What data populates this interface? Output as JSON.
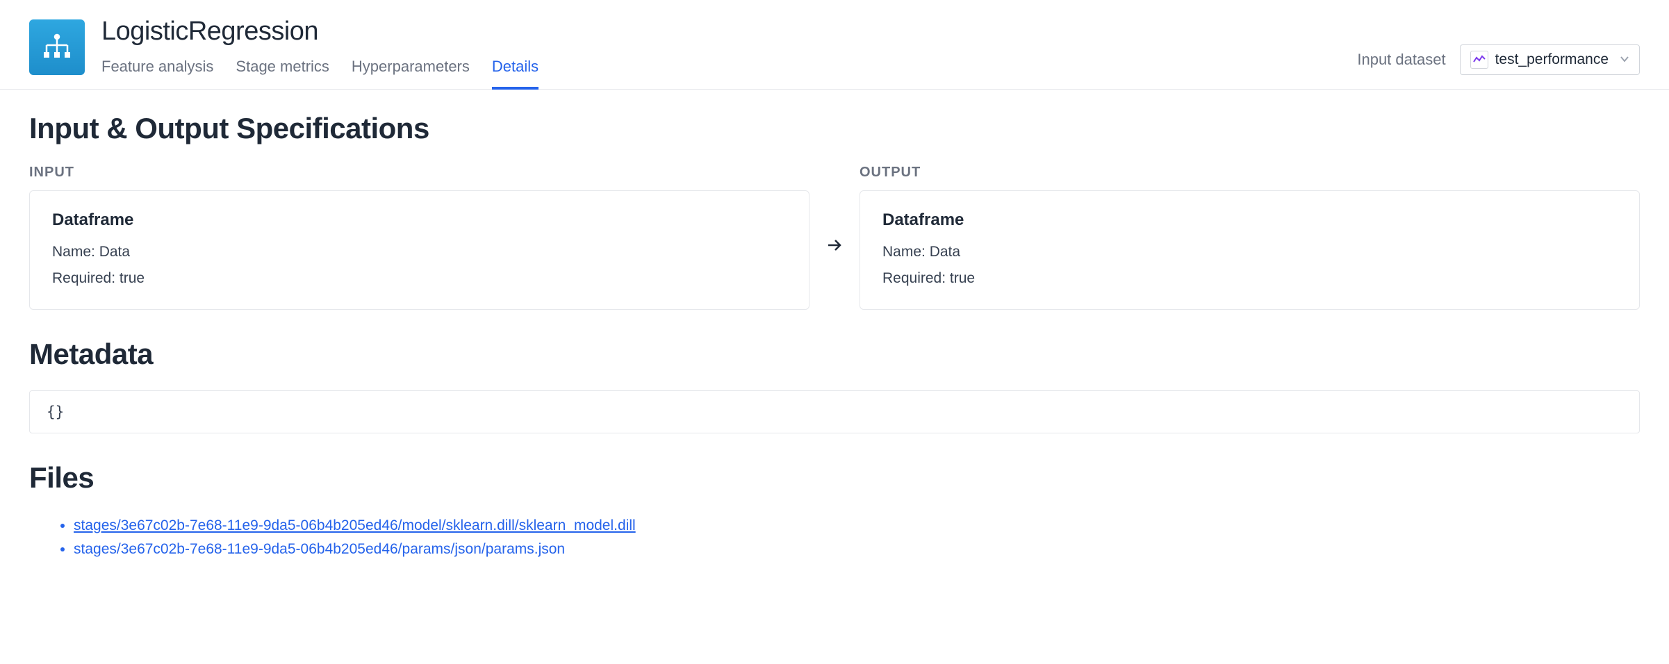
{
  "header": {
    "title": "LogisticRegression",
    "tabs": [
      {
        "label": "Feature analysis",
        "active": false
      },
      {
        "label": "Stage metrics",
        "active": false
      },
      {
        "label": "Hyperparameters",
        "active": false
      },
      {
        "label": "Details",
        "active": true
      }
    ],
    "input_dataset_label": "Input dataset",
    "dataset_selector_value": "test_performance"
  },
  "specs": {
    "section_title": "Input & Output Specifications",
    "input_label": "INPUT",
    "output_label": "OUTPUT",
    "input": {
      "type": "Dataframe",
      "name_label": "Name:",
      "name_value": "Data",
      "required_label": "Required:",
      "required_value": "true"
    },
    "output": {
      "type": "Dataframe",
      "name_label": "Name:",
      "name_value": "Data",
      "required_label": "Required:",
      "required_value": "true"
    }
  },
  "metadata": {
    "section_title": "Metadata",
    "content": "{}"
  },
  "files": {
    "section_title": "Files",
    "items": [
      {
        "path": "stages/3e67c02b-7e68-11e9-9da5-06b4b205ed46/model/sklearn.dill/sklearn_model.dill",
        "link": true
      },
      {
        "path": "stages/3e67c02b-7e68-11e9-9da5-06b4b205ed46/params/json/params.json",
        "link": false
      }
    ]
  }
}
